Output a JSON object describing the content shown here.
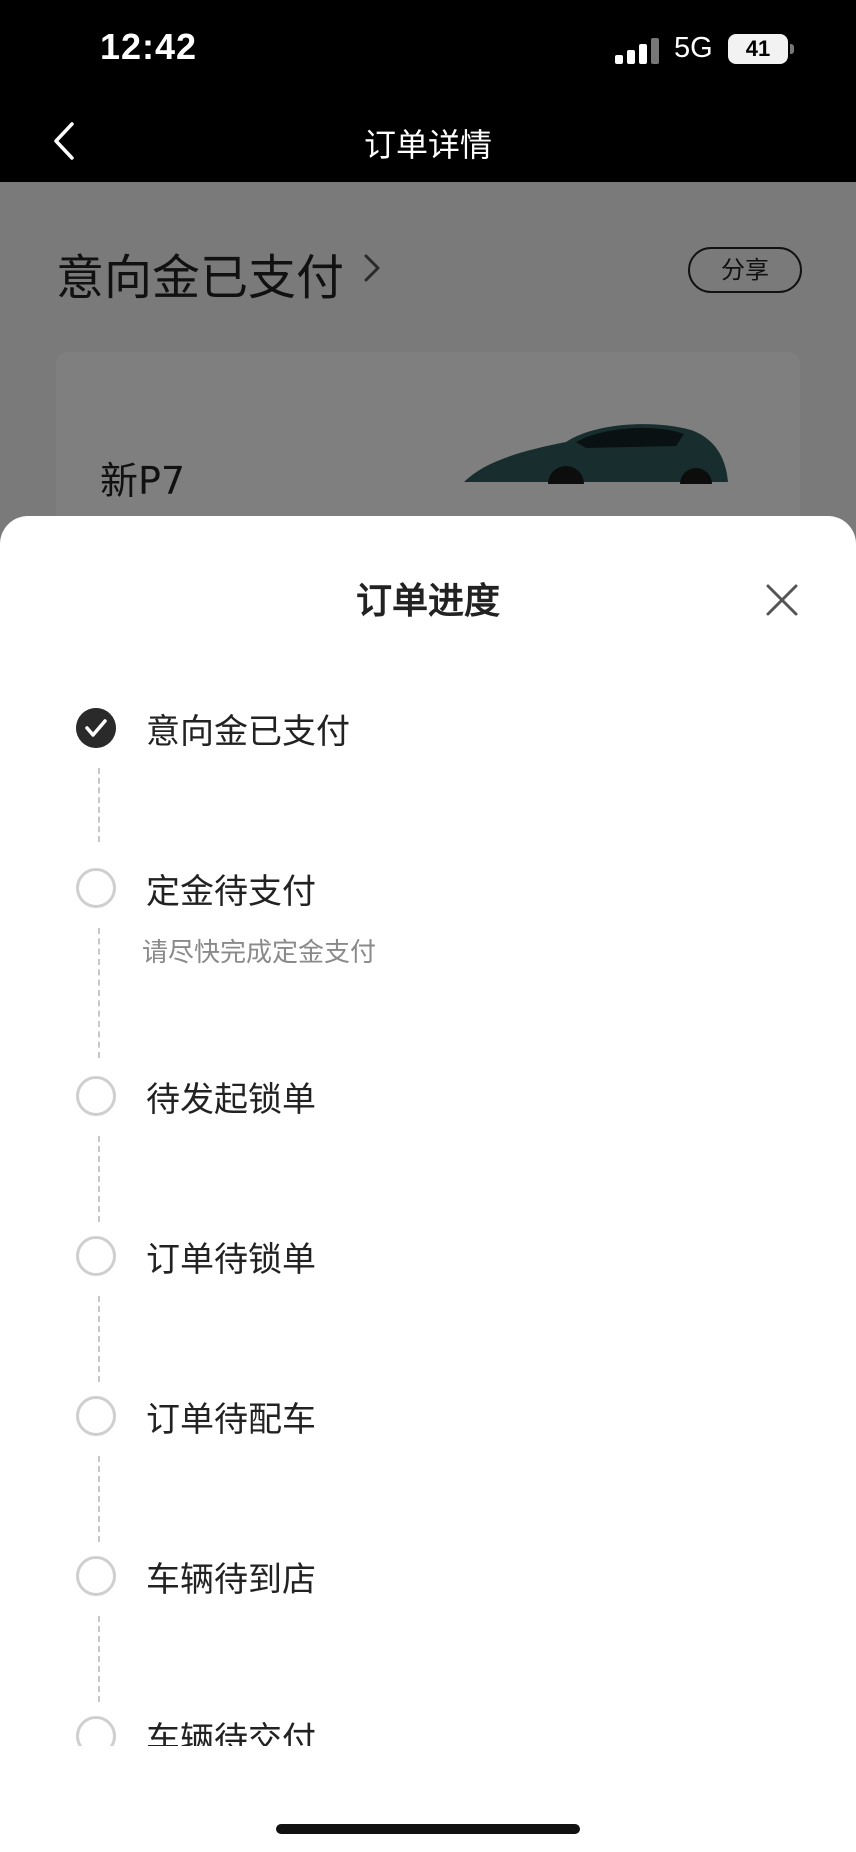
{
  "status_bar": {
    "time": "12:42",
    "network": "5G",
    "battery": "41"
  },
  "nav": {
    "title": "订单详情"
  },
  "order": {
    "status": "意向金已支付",
    "share_label": "分享",
    "car_name": "新P7"
  },
  "sheet": {
    "title": "订单进度",
    "steps": [
      {
        "label": "意向金已支付",
        "completed": true
      },
      {
        "label": "定金待支付",
        "sub": "请尽快完成定金支付",
        "completed": false
      },
      {
        "label": "待发起锁单",
        "completed": false
      },
      {
        "label": "订单待锁单",
        "completed": false
      },
      {
        "label": "订单待配车",
        "completed": false
      },
      {
        "label": "车辆待到店",
        "completed": false
      },
      {
        "label": "车辆待交付",
        "completed": false
      }
    ]
  },
  "colors": {
    "check_fill": "#2a2a2a",
    "pending_border": "#cfcfcf",
    "sub_text": "#8a8a8a"
  }
}
